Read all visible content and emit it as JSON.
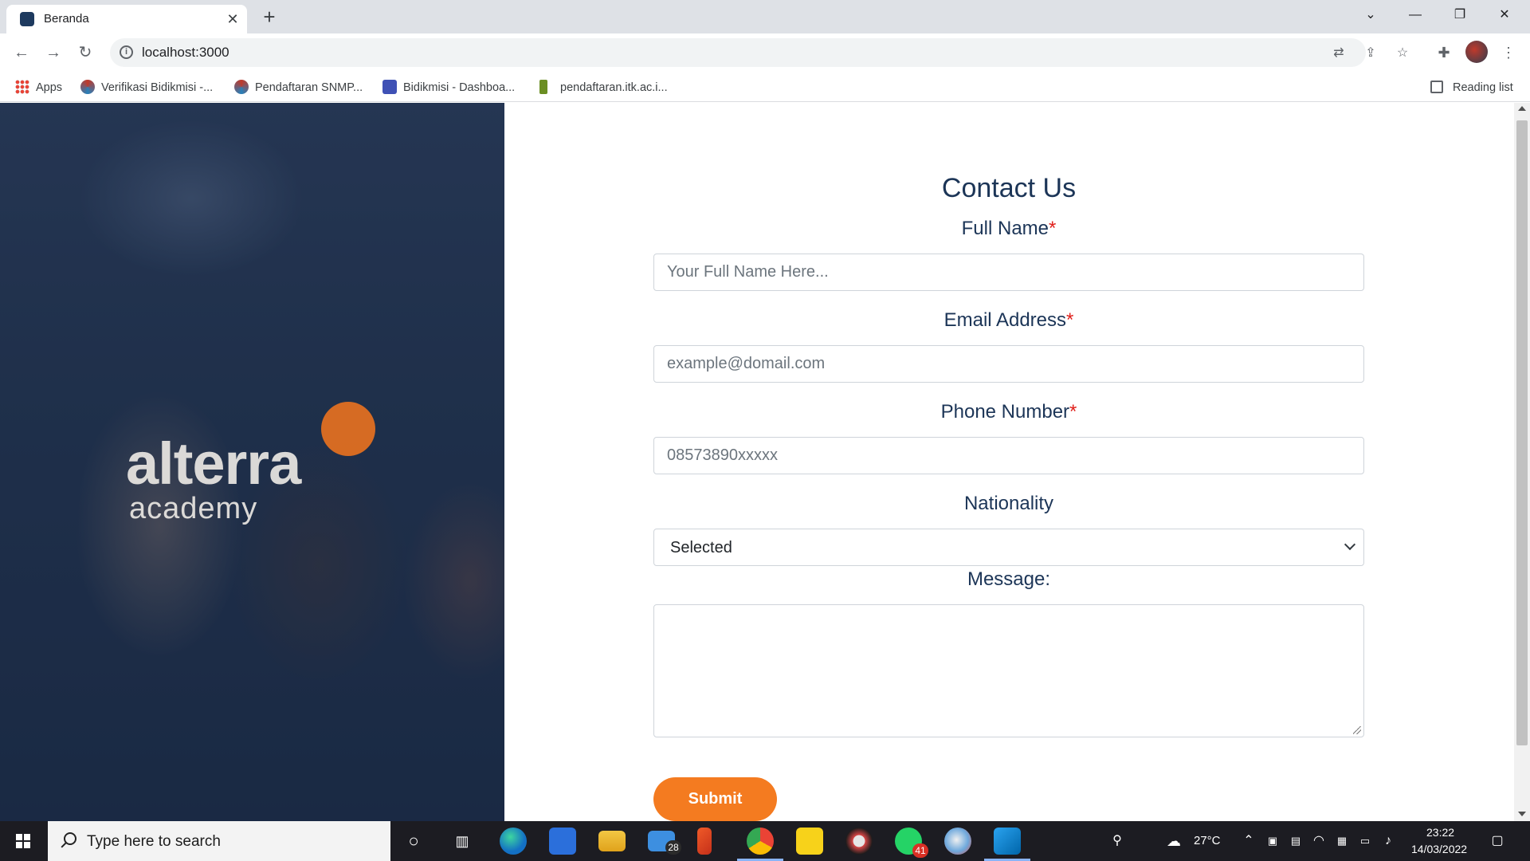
{
  "browser": {
    "tab_title": "Beranda",
    "url": "localhost:3000",
    "bookmarks": [
      {
        "label": "Apps"
      },
      {
        "label": "Verifikasi Bidikmisi -..."
      },
      {
        "label": "Pendaftaran SNMP..."
      },
      {
        "label": "Bidikmisi - Dashboa..."
      },
      {
        "label": "pendaftaran.itk.ac.i..."
      }
    ],
    "reading_list": "Reading list"
  },
  "hero": {
    "logo_main": "alterra",
    "logo_sub": "academy"
  },
  "form": {
    "title": "Contact Us",
    "required_mark": "*",
    "full_name": {
      "label": "Full Name",
      "placeholder": "Your Full Name Here..."
    },
    "email": {
      "label": "Email Address",
      "placeholder": "example@domail.com"
    },
    "phone": {
      "label": "Phone Number",
      "placeholder": "08573890xxxxx"
    },
    "nationality": {
      "label": "Nationality",
      "selected": "Selected"
    },
    "message": {
      "label": "Message:"
    },
    "submit_label": "Submit"
  },
  "taskbar": {
    "search_placeholder": "Type here to search",
    "mail_badge": "28",
    "whatsapp_badge": "41",
    "weather": "27°C",
    "time": "23:22",
    "date": "14/03/2022"
  },
  "colors": {
    "accent": "#f47b20",
    "heading": "#1c3557",
    "required": "#e0201b"
  }
}
